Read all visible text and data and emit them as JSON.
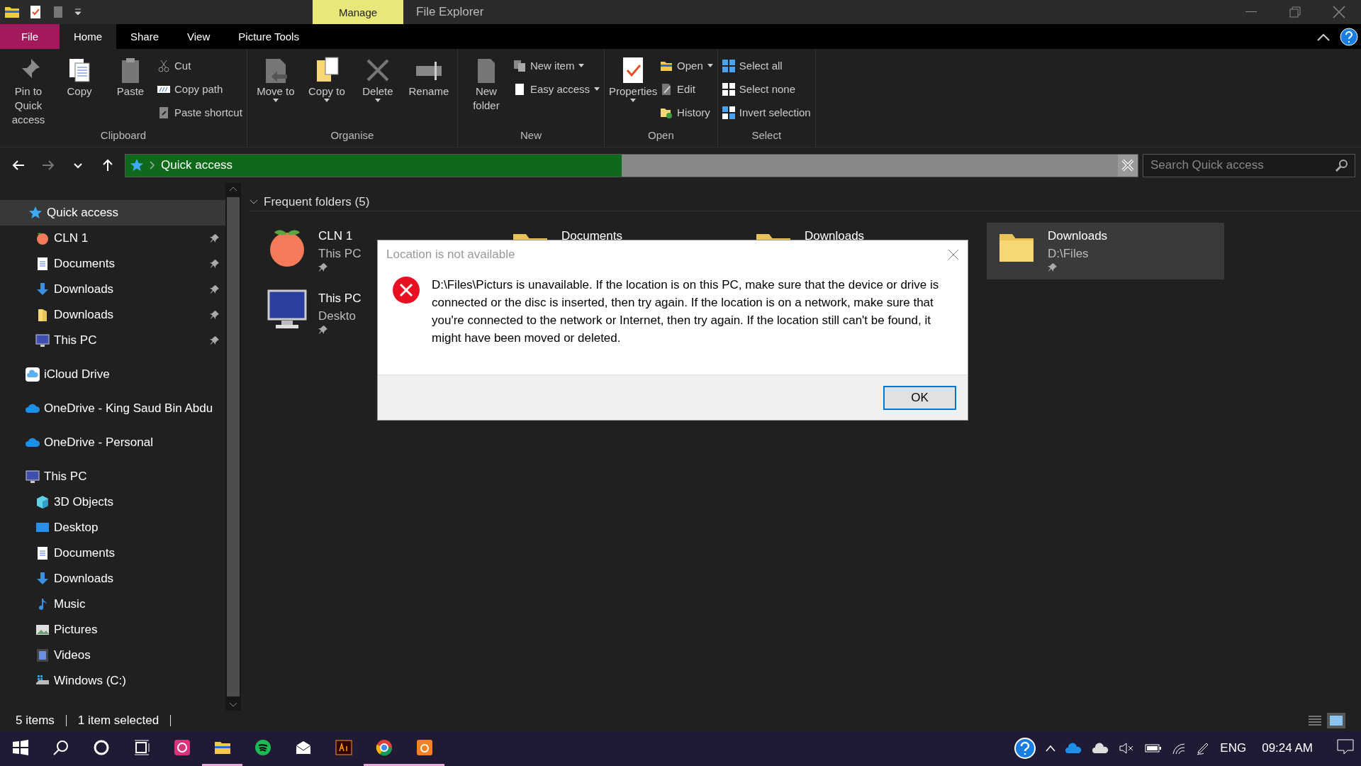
{
  "window": {
    "context_tab": "Manage",
    "title": "File Explorer"
  },
  "ribbon_tabs": [
    {
      "label": "File",
      "kind": "file",
      "selected": false
    },
    {
      "label": "Home",
      "kind": "tab",
      "selected": true
    },
    {
      "label": "Share",
      "kind": "tab",
      "selected": false
    },
    {
      "label": "View",
      "kind": "tab",
      "selected": false
    },
    {
      "label": "Picture Tools",
      "kind": "tab",
      "selected": false
    }
  ],
  "ribbon_groups": [
    {
      "label": "Clipboard",
      "items": [
        {
          "kind": "large",
          "label": "Pin to Quick access",
          "dropdown": false
        },
        {
          "kind": "large",
          "label": "Copy",
          "dropdown": false
        },
        {
          "kind": "large",
          "label": "Paste",
          "dropdown": false
        },
        {
          "kind": "small",
          "label": "Cut",
          "dropdown": false
        },
        {
          "kind": "small",
          "label": "Copy path",
          "dropdown": false
        },
        {
          "kind": "small",
          "label": "Paste shortcut",
          "dropdown": false
        }
      ]
    },
    {
      "label": "Organise",
      "items": [
        {
          "kind": "large",
          "label": "Move to",
          "dropdown": true
        },
        {
          "kind": "large",
          "label": "Copy to",
          "dropdown": true
        },
        {
          "kind": "large",
          "label": "Delete",
          "dropdown": true
        },
        {
          "kind": "large",
          "label": "Rename",
          "dropdown": false
        }
      ]
    },
    {
      "label": "New",
      "items": [
        {
          "kind": "large",
          "label": "New folder",
          "dropdown": false
        },
        {
          "kind": "small",
          "label": "New item",
          "dropdown": true
        },
        {
          "kind": "small",
          "label": "Easy access",
          "dropdown": true
        }
      ]
    },
    {
      "label": "Open",
      "items": [
        {
          "kind": "large",
          "label": "Properties",
          "dropdown": true
        },
        {
          "kind": "small",
          "label": "Open",
          "dropdown": true
        },
        {
          "kind": "small",
          "label": "Edit",
          "dropdown": false
        },
        {
          "kind": "small",
          "label": "History",
          "dropdown": false
        }
      ]
    },
    {
      "label": "Select",
      "items": [
        {
          "kind": "small",
          "label": "Select all",
          "dropdown": false
        },
        {
          "kind": "small",
          "label": "Select none",
          "dropdown": false
        },
        {
          "kind": "small",
          "label": "Invert selection",
          "dropdown": false
        }
      ]
    }
  ],
  "nav_buttons": [
    {
      "disabled": false
    },
    {
      "disabled": true
    },
    {
      "disabled": false
    },
    {
      "disabled": false
    }
  ],
  "address": {
    "path": "Quick access",
    "level": 0.49
  },
  "search": {
    "placeholder": "Search Quick access"
  },
  "sidebar": {
    "items": [
      {
        "label": "Quick access",
        "selected": true,
        "children": [
          {
            "label": "CLN 1",
            "pinned": true,
            "selected": false
          },
          {
            "label": "Documents",
            "pinned": true,
            "selected": false
          },
          {
            "label": "Downloads",
            "pinned": true,
            "selected": false
          },
          {
            "label": "Downloads",
            "pinned": true,
            "selected": false
          },
          {
            "label": "This PC",
            "pinned": true,
            "selected": false
          }
        ]
      },
      {
        "label": "iCloud Drive",
        "selected": false
      },
      {
        "label": "OneDrive - King Saud Bin Abdu",
        "selected": false
      },
      {
        "label": "OneDrive - Personal",
        "selected": false
      },
      {
        "label": "This PC",
        "selected": false,
        "children": [
          {
            "label": "3D Objects",
            "selected": false
          },
          {
            "label": "Desktop",
            "selected": false
          },
          {
            "label": "Documents",
            "selected": false
          },
          {
            "label": "Downloads",
            "selected": false
          },
          {
            "label": "Music",
            "selected": false
          },
          {
            "label": "Pictures",
            "selected": false
          },
          {
            "label": "Videos",
            "selected": false
          },
          {
            "label": "Windows (C:)",
            "selected": false
          }
        ]
      }
    ]
  },
  "frequent": {
    "header": "Frequent folders (5)",
    "expanded": true,
    "items": [
      {
        "name": "CLN 1",
        "location": "This PC",
        "pinned": true,
        "selected": false
      },
      {
        "name": "Documents",
        "selected": false
      },
      {
        "name": "Downloads",
        "selected": false
      },
      {
        "name": "Downloads",
        "location": "D:\\Files",
        "pinned": true,
        "selected": true
      },
      {
        "name": "This PC",
        "location": "Deskto",
        "pinned": true,
        "selected": false
      }
    ]
  },
  "dialog": {
    "title": "Location is not available",
    "message": "D:\\Files\\Picturs is unavailable. If the location is on this PC, make sure that the device or drive is connected or the disc is inserted, then try again. If the location is on a network, make sure that you're connected to the network or Internet, then try again. If the location still can't be found, it might have been moved or deleted.",
    "button": "OK"
  },
  "status_bar": {
    "items": "5 items",
    "selection": "1 item selected",
    "views": [
      {
        "selected": false
      },
      {
        "selected": true
      }
    ]
  },
  "taskbar": {
    "apps": [
      {
        "running": false
      },
      {
        "running": false
      },
      {
        "running": false
      },
      {
        "running": false
      },
      {
        "running": true
      },
      {
        "running": false
      },
      {
        "running": false
      },
      {
        "running": false
      },
      {
        "running": true
      },
      {
        "running": true
      }
    ],
    "language": "ENG",
    "time": "09:24 AM"
  }
}
